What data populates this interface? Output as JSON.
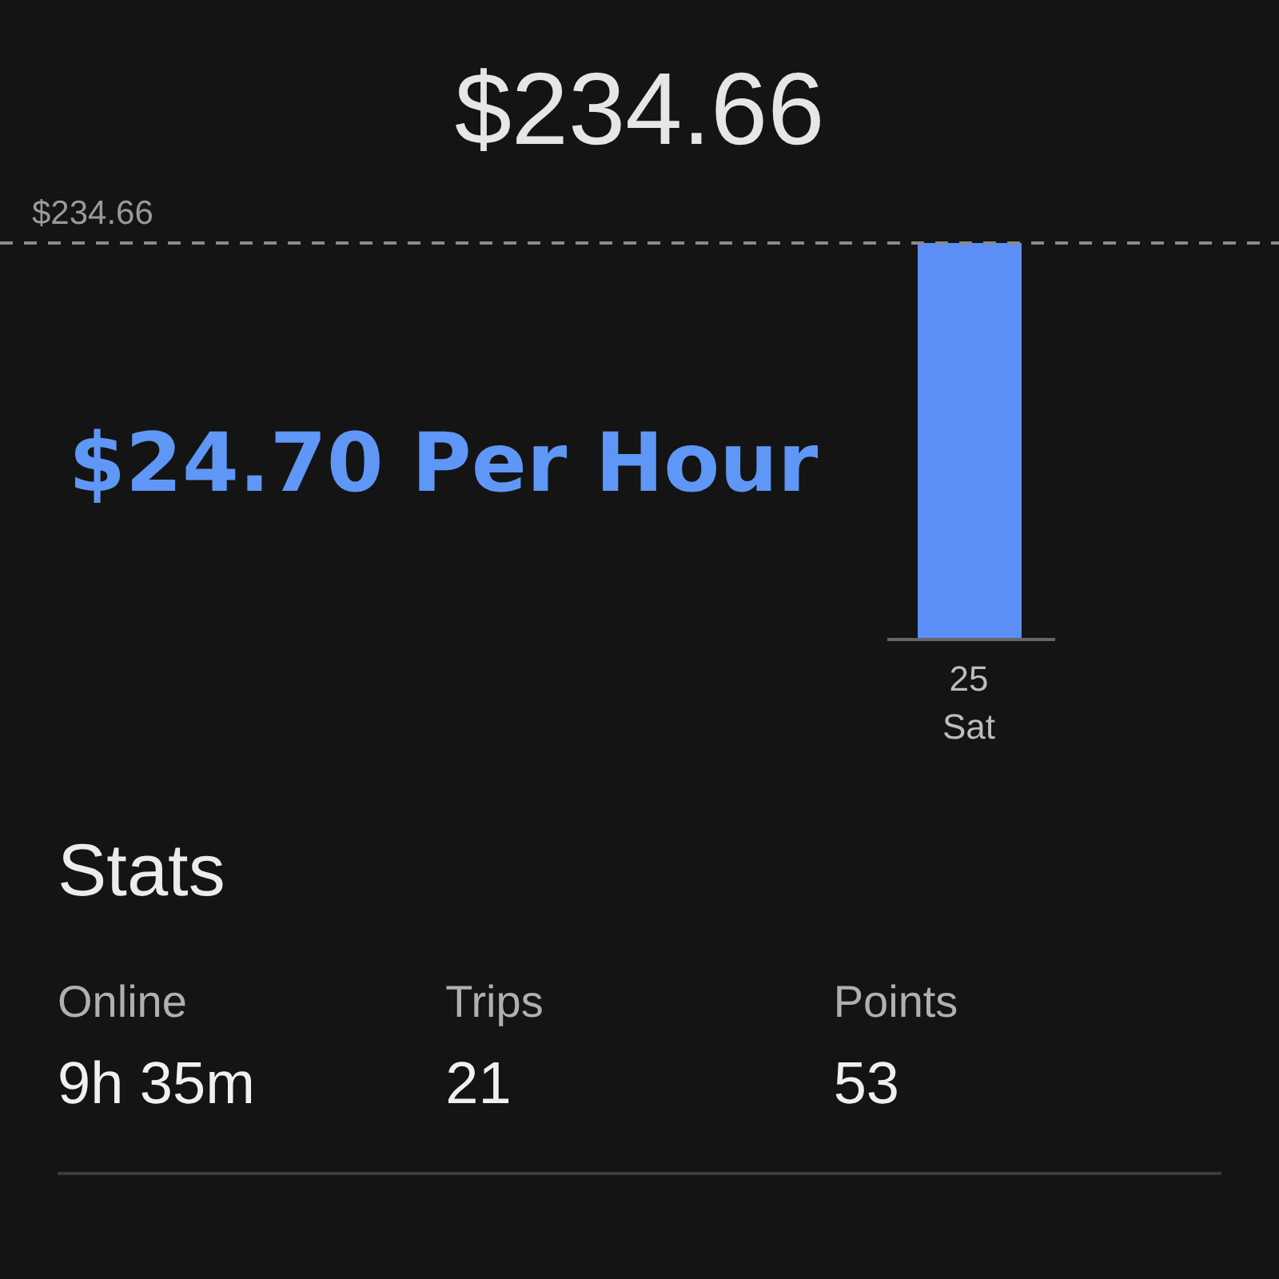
{
  "header": {
    "total": "$234.66"
  },
  "chart": {
    "reference_line_label": "$234.66",
    "bars": [
      {
        "day": "25",
        "weekday": "Sat"
      }
    ]
  },
  "overlay": {
    "text": "$24.70 Per Hour"
  },
  "stats": {
    "title": "Stats",
    "items": [
      {
        "label": "Online",
        "value": "9h 35m"
      },
      {
        "label": "Trips",
        "value": "21"
      },
      {
        "label": "Points",
        "value": "53"
      }
    ]
  }
}
